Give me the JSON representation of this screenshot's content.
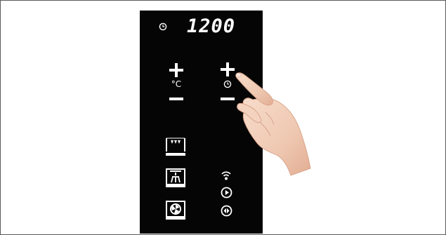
{
  "display": {
    "time": "1200"
  },
  "controls": {
    "temperature": {
      "unit_label": "°C"
    },
    "timer": {}
  },
  "icons": {
    "display_clock": "clock-icon",
    "temp_plus": "plus-icon",
    "temp_minus": "minus-icon",
    "timer_plus": "plus-icon",
    "timer_minus": "minus-icon",
    "timer_symbol": "clock-icon",
    "top_heat": "top-heating-icon",
    "grill": "grill-icon",
    "fan": "fan-oven-icon",
    "wifi": "wifi-icon",
    "play": "play-icon",
    "rewind_forward": "rewind-forward-icon",
    "hand": "pointing-hand-icon"
  },
  "colors": {
    "panel": "#050505",
    "icon": "#ffffff",
    "frame_border": "#5a5a5a"
  }
}
